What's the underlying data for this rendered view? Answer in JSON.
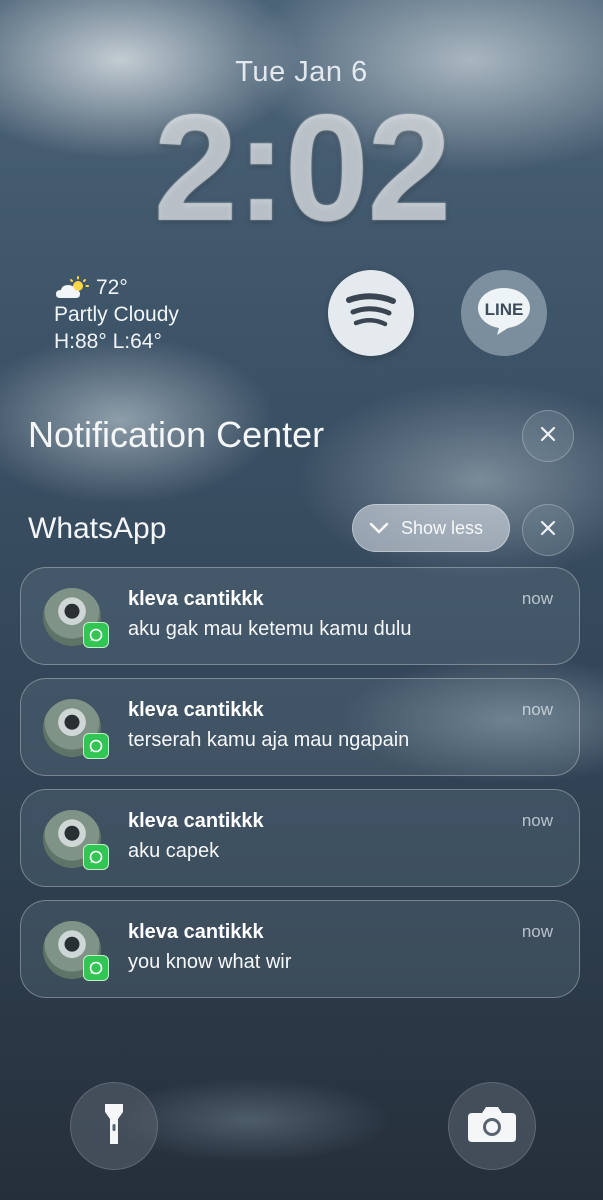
{
  "lockscreen": {
    "date": "Tue Jan 6",
    "time": "2:02"
  },
  "weather": {
    "temp": "72°",
    "condition": "Partly Cloudy",
    "high_low": "H:88° L:64°",
    "icon": "partly-cloudy-icon"
  },
  "widgets": [
    {
      "name": "Spotify",
      "icon": "spotify-icon"
    },
    {
      "name": "LINE",
      "label": "LINE",
      "icon": "line-icon"
    }
  ],
  "notification_center": {
    "title": "Notification Center"
  },
  "group": {
    "app": "WhatsApp",
    "show_less_label": "Show less"
  },
  "notifications": [
    {
      "sender": "kleva cantikkk",
      "message": "aku gak mau ketemu kamu dulu",
      "time": "now"
    },
    {
      "sender": "kleva cantikkk",
      "message": "terserah kamu aja mau ngapain",
      "time": "now"
    },
    {
      "sender": "kleva cantikkk",
      "message": "aku capek",
      "time": "now"
    },
    {
      "sender": "kleva cantikkk",
      "message": "you know what wir",
      "time": "now"
    }
  ],
  "bottom_actions": {
    "left_icon": "flashlight-icon",
    "right_icon": "camera-icon"
  },
  "colors": {
    "whatsapp_green": "#31c553",
    "line_green": "#e8eef3"
  }
}
